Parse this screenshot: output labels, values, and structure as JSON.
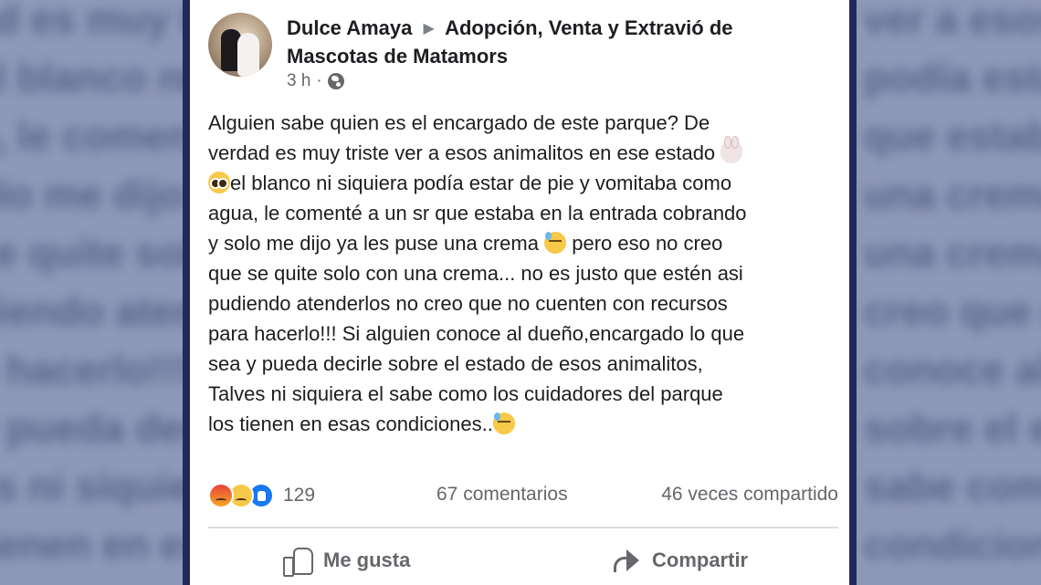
{
  "post": {
    "author": "Dulce Amaya",
    "group": "Adopción, Venta y Extravió de Mascotas de Matamors",
    "time": "3 h",
    "separator": "·",
    "lines": [
      "Alguien sabe quien es el encargado de este parque? De",
      "verdad es muy triste ver a esos animalitos en ese estado",
      "el blanco ni siquiera podía estar de pie y vomitaba como",
      "agua, le comenté a un sr que estaba en la entrada cobrando",
      "y solo me dijo ya les puse una crema",
      "pero eso no creo",
      "que se quite solo con una crema... no es justo que estén asi",
      "pudiendo atenderlos no creo que no cuenten con recursos",
      "para hacerlo!!! Si alguien conoce al dueño,encargado lo que",
      "sea  y pueda decirle sobre el estado de esos animalitos,",
      "Talves ni siquiera el sabe como los cuidadores del parque",
      "los tienen en esas condiciones.."
    ],
    "emoji_icons": [
      "rabbit-face-icon",
      "pleading-face-icon",
      "downcast-face-icon",
      "downcast-face-icon"
    ]
  },
  "stats": {
    "reaction_icons": [
      "angry-reaction-icon",
      "sad-reaction-icon",
      "like-reaction-icon"
    ],
    "reaction_count": "129",
    "comments": "67 comentarios",
    "shares": "46 veces compartido"
  },
  "actions": {
    "like_label": "Me gusta",
    "share_label": "Compartir"
  },
  "background": {
    "blurred_text": [
      "ad es muy triste",
      "el blanco ni siquiera",
      "a, le comenté a un",
      "olo me dijo ya les",
      "se quite solo con",
      "diendo atenderlos",
      "a hacerlo!!! Si alg",
      "y pueda decirle",
      "es ni siquiera el",
      "tienen en esas"
    ],
    "blurred_text_right": [
      "ver a esos animalitos",
      "podía estar de pie",
      "que estaba en la",
      "una crema pero eso",
      "una crema... no es",
      "creo que no cuenten",
      "conoce al dueño",
      "sobre el estado",
      "sabe como los",
      "condiciones.."
    ],
    "colors": {
      "side": "#8e98b8",
      "border": "#1f2a5b"
    }
  }
}
